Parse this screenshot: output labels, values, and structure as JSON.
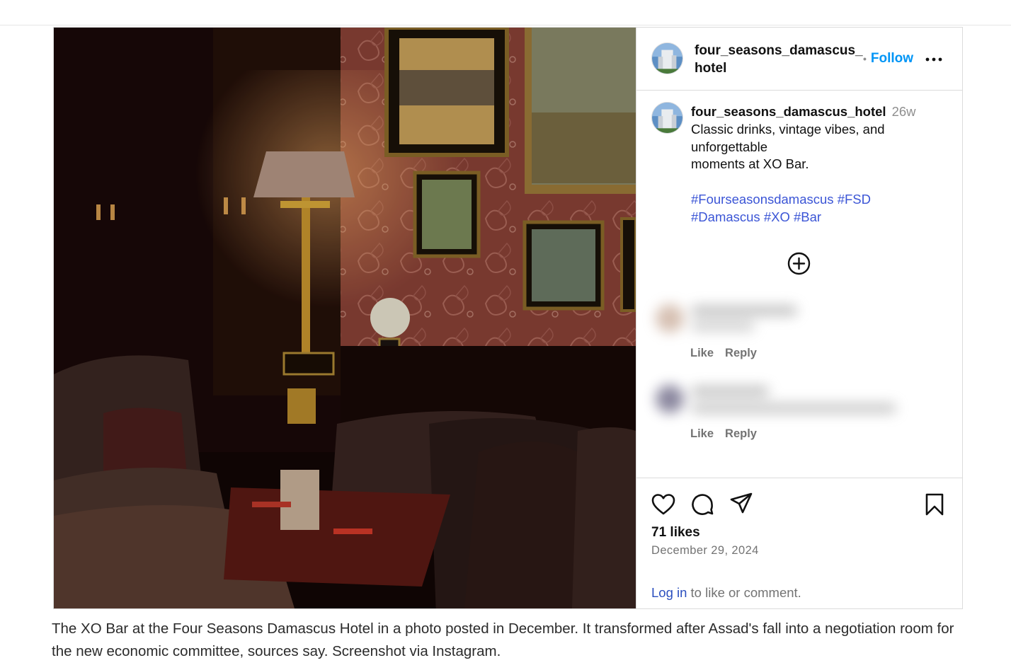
{
  "post": {
    "header": {
      "username": "four_seasons_damascus_hotel",
      "separator": "•",
      "follow_label": "Follow",
      "more_icon": "more-horizontal-icon"
    },
    "caption": {
      "username": "four_seasons_damascus_hotel",
      "time_ago": "26w",
      "line1": "Classic drinks, vintage vibes, and",
      "line2": "unforgettable",
      "line3": "moments at XO Bar.",
      "tags_line1": "#Fourseasonsdamascus #FSD",
      "tags_line2": "#Damascus #XO #Bar"
    },
    "load_more_icon": "plus-circle-icon",
    "comments": [
      {
        "like_label": "Like",
        "reply_label": "Reply"
      },
      {
        "like_label": "Like",
        "reply_label": "Reply"
      }
    ],
    "actions": {
      "like_icon": "heart-icon",
      "comment_icon": "comment-icon",
      "share_icon": "share-icon",
      "save_icon": "bookmark-icon"
    },
    "likes_text": "71 likes",
    "date_text": "December 29, 2024",
    "login_link": "Log in",
    "login_suffix": "to like or comment."
  },
  "article_caption": "The XO Bar at the Four Seasons Damascus Hotel in a photo posted in December. It transformed after Assad's fall into a negotiation room for the new economic committee, sources say. Screenshot via Instagram.",
  "colors": {
    "link_blue": "#0095f6",
    "hashtag_blue": "#3b55d6",
    "muted_gray": "#737373"
  }
}
